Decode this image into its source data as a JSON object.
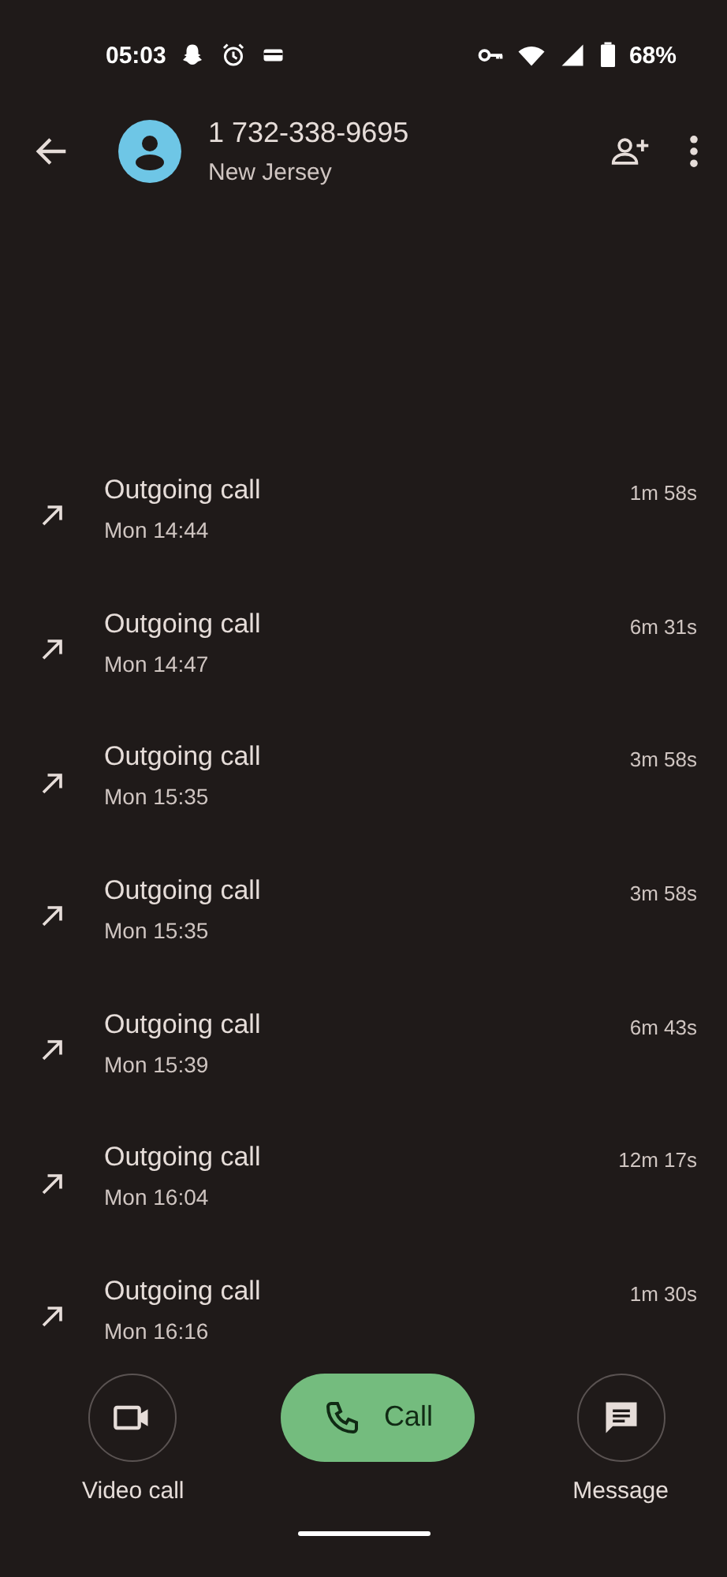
{
  "status_bar": {
    "time": "05:03",
    "battery": "68%"
  },
  "contact": {
    "number": "1 732-338-9695",
    "location": "New Jersey"
  },
  "calls": [
    {
      "kind": "outgoing",
      "label": "Outgoing call",
      "time": "Mon 14:44",
      "duration": "1m 58s"
    },
    {
      "kind": "outgoing",
      "label": "Outgoing call",
      "time": "Mon 14:47",
      "duration": "6m 31s"
    },
    {
      "kind": "outgoing",
      "label": "Outgoing call",
      "time": "Mon 15:35",
      "duration": "3m 58s"
    },
    {
      "kind": "outgoing",
      "label": "Outgoing call",
      "time": "Mon 15:35",
      "duration": "3m 58s"
    },
    {
      "kind": "outgoing",
      "label": "Outgoing call",
      "time": "Mon 15:39",
      "duration": "6m 43s"
    },
    {
      "kind": "outgoing",
      "label": "Outgoing call",
      "time": "Mon 16:04",
      "duration": "12m 17s"
    },
    {
      "kind": "outgoing",
      "label": "Outgoing call",
      "time": "Mon 16:16",
      "duration": "1m 30s"
    }
  ],
  "actions": {
    "video_call": "Video call",
    "call": "Call",
    "message": "Message"
  }
}
